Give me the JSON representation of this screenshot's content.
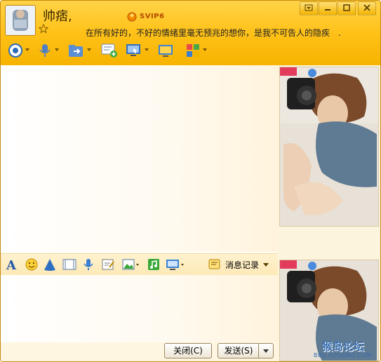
{
  "header": {
    "nickname": "帅痞,",
    "signature": "在所有好的，不好的情绪里毫无预兆的想你，是我不可告人的隐疾　.",
    "badge": "SVIP6"
  },
  "toolbar": {
    "icons": [
      "video-call-icon",
      "voice-call-icon",
      "send-file-icon",
      "new-group-chat-icon",
      "remote-desktop-icon",
      "share-screen-icon",
      "apps-icon"
    ]
  },
  "input_toolbar": {
    "record_label": "消息记录"
  },
  "buttons": {
    "close": "关闭(C)",
    "send": "发送(S)"
  },
  "watermark": {
    "line1": "猴岛论坛",
    "line2": "BBS.HOUDAO.COM"
  },
  "colors": {
    "header": "#ffc21a",
    "accent": "#f7b300",
    "border": "#c98a12"
  }
}
